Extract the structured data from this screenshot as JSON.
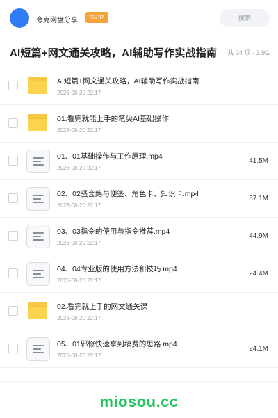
{
  "header": {
    "brand": "夸克网盘分享",
    "badge": "SVIP",
    "search_label": "搜索"
  },
  "titlebar": {
    "title": "AI短篇+网文通关攻略，AI辅助写作实战指南",
    "meta": "共 34 项 · 3.9G"
  },
  "files": [
    {
      "type": "folder",
      "name": "AI短篇+网文通关攻略，AI辅助写作实战指南",
      "date": "2026-08-20 22:17",
      "size": ""
    },
    {
      "type": "folder",
      "name": "01.看完就能上手的笔尖AI基础操作",
      "date": "2026-08-20 22:17",
      "size": ""
    },
    {
      "type": "file",
      "name": "01、01基础操作与工作原理.mp4",
      "date": "2026-08-20 22:17",
      "size": "41.5M"
    },
    {
      "type": "file",
      "name": "02、02骚套路与便签、角色卡、知识卡.mp4",
      "date": "2026-08-20 22:17",
      "size": "67.1M"
    },
    {
      "type": "file",
      "name": "03、03指令的使用与指令推荐.mp4",
      "date": "2026-08-20 22:17",
      "size": "44.9M"
    },
    {
      "type": "file",
      "name": "04、04专业版的使用方法和技巧.mp4",
      "date": "2026-08-20 22:17",
      "size": "24.4M"
    },
    {
      "type": "folder",
      "name": "02.看完就上手的网文通关课",
      "date": "2026-08-20 22:17",
      "size": ""
    },
    {
      "type": "file",
      "name": "05、01邪修快速拿到稿费的思路.mp4",
      "date": "2026-08-20 22:17",
      "size": "24.1M"
    }
  ],
  "footer": {
    "watermark": "miosou.cc"
  },
  "colors": {
    "accent": "#2f7cf6",
    "svip": "#f6a33a",
    "folder": "#fbd34f",
    "watermark": "#22c55e"
  }
}
